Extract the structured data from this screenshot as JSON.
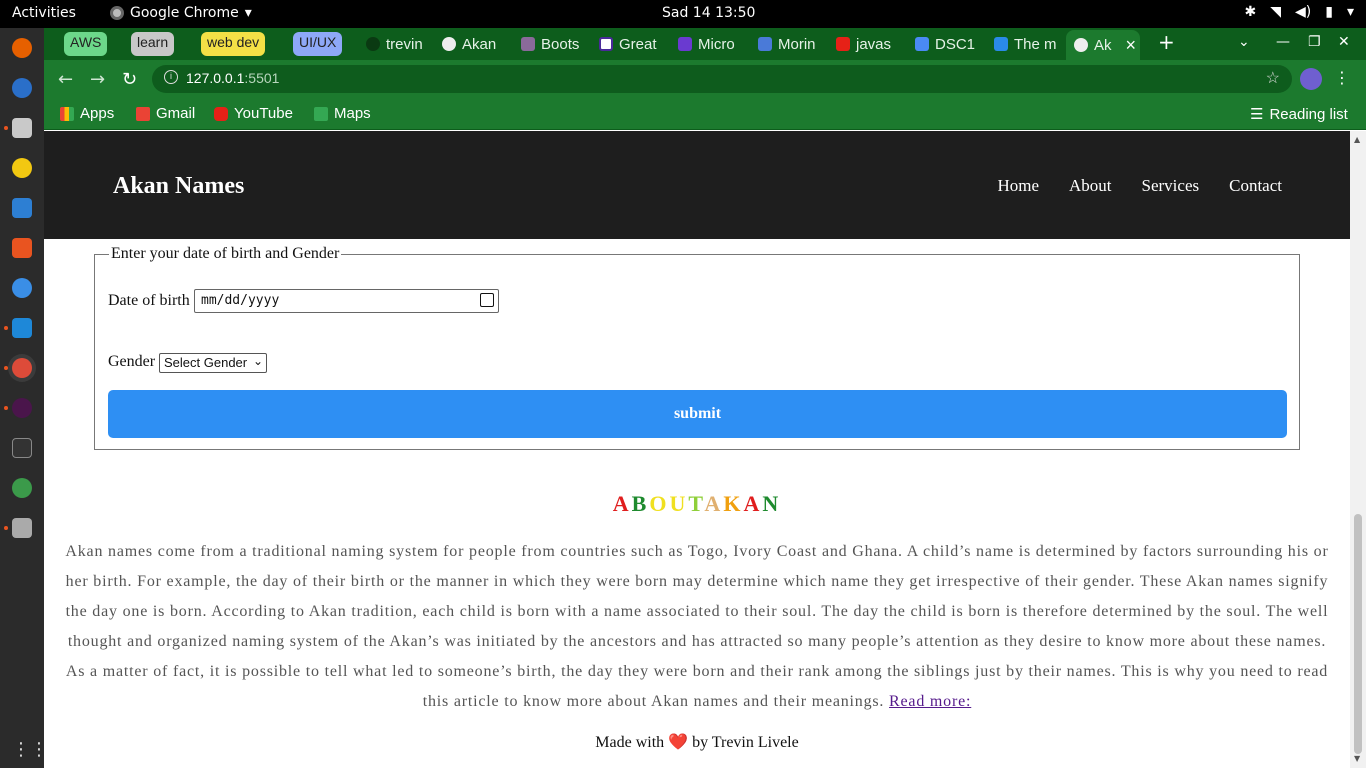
{
  "system_bar": {
    "activities": "Activities",
    "app_name": "Google Chrome",
    "app_caret": "▾",
    "clock": "Sad 14  13:50"
  },
  "tab_groups": [
    "AWS",
    "learn",
    "web dev",
    "UI/UX"
  ],
  "tabs": [
    "trevin",
    "Akan",
    "Boots",
    "Great",
    "Micro",
    "Morin",
    "javas",
    "DSC1",
    "The m",
    "Ak"
  ],
  "browser": {
    "url_host": "127.0.0.1",
    "url_port": ":5501",
    "new_tab": "+",
    "close_tab": "×"
  },
  "bookmarks": {
    "items": [
      "Apps",
      "Gmail",
      "YouTube",
      "Maps"
    ],
    "reading_list": "Reading list"
  },
  "site": {
    "brand": "Akan Names",
    "nav": [
      "Home",
      "About",
      "Services",
      "Contact"
    ],
    "form": {
      "legend": "Enter your date of birth and Gender",
      "dob_label": "Date of birth",
      "dob_placeholder": "mm/dd/yyyy",
      "gender_label": "Gender",
      "gender_selected": "Select Gender",
      "submit": "submit"
    },
    "about": {
      "title_letters": [
        {
          "ch": "A",
          "color": "#e01e1e"
        },
        {
          "ch": "B",
          "color": "#1e8a2e"
        },
        {
          "ch": "O",
          "color": "#f0e020"
        },
        {
          "ch": "U",
          "color": "#f0e020"
        },
        {
          "ch": "T",
          "color": "#8fcf3a"
        },
        {
          "ch": "A",
          "color": "#e0b070"
        },
        {
          "ch": "K",
          "color": "#f0a010"
        },
        {
          "ch": "A",
          "color": "#e01e1e"
        },
        {
          "ch": "N",
          "color": "#1e8a2e"
        }
      ],
      "text": "Akan names come from a traditional naming system for people from countries such as Togo, Ivory Coast and Ghana. A child’s name is determined by factors surrounding his or her birth. For example, the day of their birth or the manner in which they were born may determine which name they get irrespective of their gender. These Akan names signify the day one is born. According to Akan tradition, each child is born with a name associated to their soul. The day the child is born is therefore determined by the soul. The well thought and organized naming system of the Akan’s was initiated by the ancestors and has attracted so many people’s attention as they desire to know more about these names. As a matter of fact, it is possible to tell what led to someone’s birth, the day they were born and their rank among the siblings just by their names. This is why you need to read this article to know more about Akan names and their meanings.",
      "read_more": "Read more:"
    },
    "footer": {
      "before": "Made with",
      "heart": "❤️",
      "after": "by Trevin Livele"
    }
  }
}
